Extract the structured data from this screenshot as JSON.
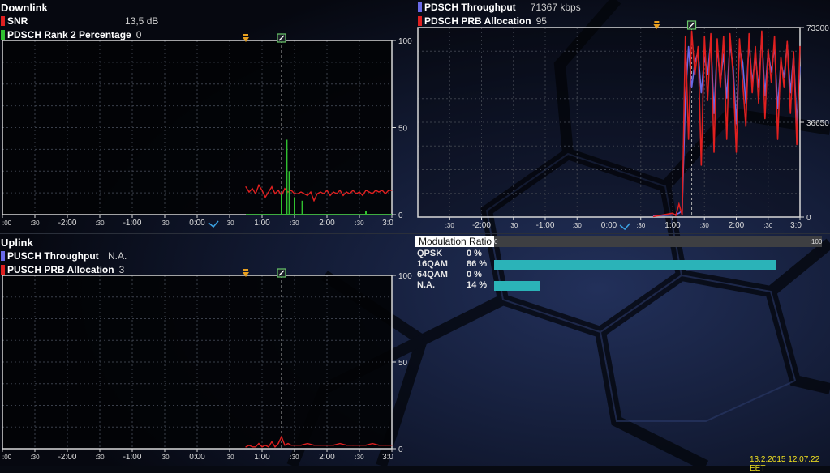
{
  "downlink": {
    "section_title": "Downlink",
    "legend": [
      {
        "name": "SNR",
        "value": "13,5 dB",
        "color": "#e02020"
      },
      {
        "name": "PDSCH Rank 2 Percentage",
        "value": "0",
        "color": "#30c030"
      }
    ]
  },
  "throughput_dl": {
    "legend": [
      {
        "name": "PDSCH Throughput",
        "value": "71367 kbps",
        "color": "#6a6ae8"
      },
      {
        "name": "PDSCH PRB Allocation",
        "value": "95",
        "color": "#e02020"
      }
    ]
  },
  "uplink": {
    "section_title": "Uplink",
    "legend": [
      {
        "name": "PUSCH Throughput",
        "value": "N.A.",
        "color": "#6a6ae8"
      },
      {
        "name": "PUSCH PRB Allocation",
        "value": "3",
        "color": "#e02020"
      }
    ]
  },
  "modulation": {
    "title": "Modulation Ratio",
    "scale_min": "0",
    "scale_max": "100",
    "rows": [
      {
        "label": "QPSK",
        "value": "0 %",
        "fraction": 0.0
      },
      {
        "label": "16QAM",
        "value": "86 %",
        "fraction": 0.86
      },
      {
        "label": "64QAM",
        "value": "0 %",
        "fraction": 0.0
      },
      {
        "label": "N.A.",
        "value": "14 %",
        "fraction": 0.14
      }
    ],
    "bar_color": "#2bb3b8"
  },
  "timestamp": "13.2.2015 12.07.22 EET",
  "chart_data": [
    {
      "type": "line",
      "id": "downlink",
      "x_tick_labels": [
        ":00",
        ":30",
        "-2:00",
        ":30",
        "-1:00",
        ":30",
        "0:00",
        ":30",
        "1:00",
        ":30",
        "2:00",
        ":30",
        "3:0"
      ],
      "x_ticks": [
        -3.0,
        -2.5,
        -2.0,
        -1.5,
        -1.0,
        -0.5,
        0.0,
        0.5,
        1.0,
        1.5,
        2.0,
        2.5,
        3.0
      ],
      "y_tick_labels": [
        "0",
        "50",
        "100"
      ],
      "ylim": [
        0,
        100
      ],
      "x_range": [
        -3.0,
        3.0
      ],
      "markers": [
        {
          "x": 0.75,
          "symbol": "diamond",
          "color": "#e8a020"
        },
        {
          "x": 1.3,
          "symbol": "flag",
          "color": "#6ac86a"
        }
      ],
      "cursor_x": 1.3,
      "series": [
        {
          "name": "SNR",
          "color": "#e02020",
          "x": [
            0.75,
            0.8,
            0.85,
            0.9,
            0.95,
            1.0,
            1.05,
            1.1,
            1.15,
            1.2,
            1.25,
            1.3,
            1.35,
            1.4,
            1.45,
            1.5,
            1.55,
            1.6,
            1.65,
            1.7,
            1.75,
            1.8,
            1.85,
            1.9,
            1.95,
            2.0,
            2.05,
            2.1,
            2.15,
            2.2,
            2.25,
            2.3,
            2.35,
            2.4,
            2.45,
            2.5,
            2.55,
            2.6,
            2.65,
            2.7,
            2.75,
            2.8,
            2.85,
            2.9,
            2.95,
            3.0
          ],
          "y": [
            16,
            13,
            15,
            12,
            17,
            14,
            10,
            13,
            16,
            12,
            14,
            11,
            15,
            13,
            14,
            12,
            12,
            13,
            12,
            11,
            13,
            8,
            12,
            13,
            12,
            14,
            11,
            13,
            12,
            14,
            11,
            13,
            12,
            14,
            12,
            13,
            11,
            14,
            13,
            12,
            14,
            13,
            14,
            12,
            14,
            14
          ]
        },
        {
          "name": "PDSCH Rank 2 Percentage",
          "color": "#30c030",
          "x": [
            0.75,
            1.25,
            1.3,
            1.32,
            1.35,
            1.38,
            1.4,
            1.42,
            1.45,
            1.48,
            1.5,
            1.53,
            1.55,
            1.58,
            1.62,
            1.65,
            1.7,
            2.0,
            2.5,
            2.6,
            2.65,
            2.7,
            3.0
          ],
          "y": [
            0,
            0,
            12,
            0,
            0,
            43,
            0,
            25,
            0,
            0,
            10,
            0,
            0,
            0,
            8,
            0,
            0,
            0,
            0,
            2,
            0,
            0,
            0
          ]
        }
      ]
    },
    {
      "type": "line",
      "id": "throughput_dl",
      "x_tick_labels": [
        ":30",
        "-2:00",
        ":30",
        "-1:00",
        ":30",
        "0:00",
        ":30",
        "1:00",
        ":30",
        "2:00",
        ":30",
        "3:0"
      ],
      "x_ticks": [
        -2.5,
        -2.0,
        -1.5,
        -1.0,
        -0.5,
        0.0,
        0.5,
        1.0,
        1.5,
        2.0,
        2.5,
        3.0
      ],
      "y_tick_labels": [
        "0",
        "36650",
        "73300"
      ],
      "ylim": [
        0,
        73300
      ],
      "x_range": [
        -3.0,
        3.0
      ],
      "markers": [
        {
          "x": 0.75,
          "symbol": "diamond",
          "color": "#e8a020"
        },
        {
          "x": 1.3,
          "symbol": "flag",
          "color": "#6ac86a"
        }
      ],
      "cursor_x": 1.3,
      "series": [
        {
          "name": "PDSCH Throughput",
          "color": "#6a6ae8",
          "x": [
            0.7,
            1.0,
            1.05,
            1.1,
            1.15,
            1.2,
            1.25,
            1.3,
            1.35,
            1.4,
            1.45,
            1.5,
            1.55,
            1.6,
            1.65,
            1.7,
            1.75,
            1.8,
            1.85,
            1.9,
            1.95,
            2.0,
            2.05,
            2.1,
            2.15,
            2.2,
            2.25,
            2.3,
            2.35,
            2.4,
            2.45,
            2.5,
            2.55,
            2.6,
            2.65,
            2.7,
            2.75,
            2.8,
            2.85,
            2.9,
            2.95,
            3.0
          ],
          "y": [
            500,
            800,
            1000,
            1500,
            2500,
            45000,
            66000,
            50000,
            60000,
            64000,
            48000,
            62000,
            55000,
            69000,
            40000,
            66000,
            52000,
            63000,
            46000,
            67000,
            58000,
            36000,
            65000,
            60000,
            44000,
            68000,
            52000,
            62000,
            50000,
            70000,
            47000,
            64000,
            56000,
            66000,
            42000,
            60000,
            54000,
            67000,
            48000,
            63000,
            36000,
            58000
          ]
        },
        {
          "name": "PDSCH PRB Allocation",
          "color": "#e02020",
          "x": [
            0.7,
            1.0,
            1.05,
            1.1,
            1.15,
            1.2,
            1.25,
            1.3,
            1.35,
            1.4,
            1.45,
            1.5,
            1.55,
            1.6,
            1.65,
            1.7,
            1.75,
            1.8,
            1.85,
            1.9,
            1.95,
            2.0,
            2.05,
            2.1,
            2.15,
            2.2,
            2.25,
            2.3,
            2.35,
            2.4,
            2.45,
            2.5,
            2.55,
            2.6,
            2.65,
            2.7,
            2.75,
            2.8,
            2.85,
            2.9,
            2.95,
            3.0
          ],
          "y": [
            200,
            1500,
            600,
            5000,
            800,
            70000,
            30000,
            72000,
            55000,
            66000,
            20000,
            70000,
            45000,
            71000,
            25000,
            69000,
            50000,
            70000,
            30000,
            71000,
            55000,
            25000,
            69000,
            52000,
            35000,
            71000,
            48000,
            66000,
            44000,
            72000,
            38000,
            65000,
            52000,
            70000,
            30000,
            62000,
            50000,
            68000,
            40000,
            64000,
            28000,
            66000
          ]
        }
      ]
    },
    {
      "type": "line",
      "id": "uplink",
      "x_tick_labels": [
        ":00",
        ":30",
        "-2:00",
        ":30",
        "-1:00",
        ":30",
        "0:00",
        ":30",
        "1:00",
        ":30",
        "2:00",
        ":30",
        "3:0"
      ],
      "x_ticks": [
        -3.0,
        -2.5,
        -2.0,
        -1.5,
        -1.0,
        -0.5,
        0.0,
        0.5,
        1.0,
        1.5,
        2.0,
        2.5,
        3.0
      ],
      "y_tick_labels": [
        "0",
        "50",
        "100"
      ],
      "ylim": [
        0,
        100
      ],
      "x_range": [
        -3.0,
        3.0
      ],
      "markers": [
        {
          "x": 0.75,
          "symbol": "diamond",
          "color": "#e8a020"
        },
        {
          "x": 1.3,
          "symbol": "flag",
          "color": "#6ac86a"
        }
      ],
      "cursor_x": 1.3,
      "series": [
        {
          "name": "PUSCH PRB Allocation",
          "color": "#e02020",
          "x": [
            0.75,
            0.8,
            0.85,
            0.9,
            0.95,
            1.0,
            1.05,
            1.1,
            1.15,
            1.2,
            1.25,
            1.3,
            1.35,
            1.4,
            1.45,
            1.5,
            1.6,
            1.7,
            1.8,
            1.9,
            2.0,
            2.1,
            2.2,
            2.3,
            2.4,
            2.5,
            2.6,
            2.7,
            2.8,
            2.9,
            3.0
          ],
          "y": [
            1,
            2,
            1,
            1,
            3,
            1,
            2,
            1,
            4,
            1,
            3,
            7,
            2,
            3,
            2,
            2,
            2,
            3,
            2,
            2,
            2,
            2,
            3,
            2,
            2,
            2,
            2,
            3,
            2,
            2,
            2
          ]
        }
      ]
    }
  ]
}
